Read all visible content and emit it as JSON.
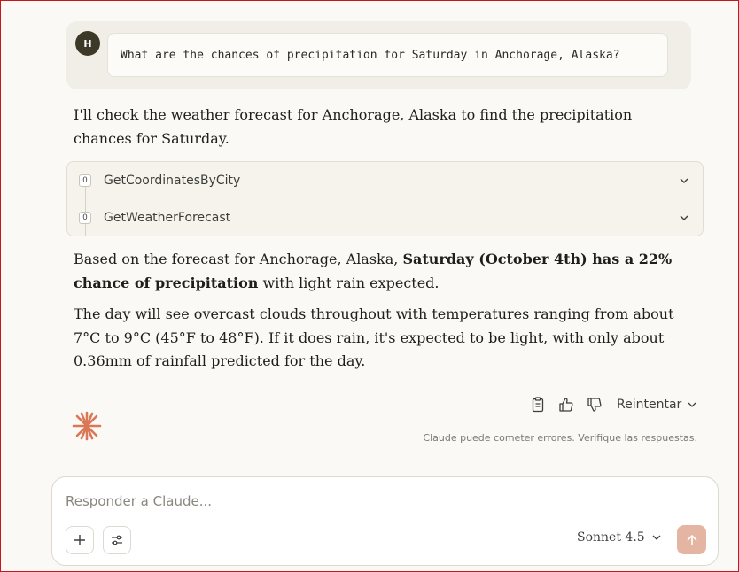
{
  "user_message": {
    "avatar_initial": "H",
    "text": "What are the chances of precipitation for Saturday in Anchorage, Alaska?"
  },
  "assistant": {
    "intro": "I'll check the weather forecast for Anchorage, Alaska to find the precipitation chances for Saturday.",
    "tools": [
      {
        "icon_text": "O",
        "name": "GetCoordinatesByCity"
      },
      {
        "icon_text": "O",
        "name": "GetWeatherForecast"
      }
    ],
    "answer_p1_pre": "Based on the forecast for Anchorage, Alaska, ",
    "answer_p1_bold": "Saturday (October 4th) has a 22% chance of precipitation",
    "answer_p1_post": " with light rain expected.",
    "answer_p2": "The day will see overcast clouds throughout with temperatures ranging from about 7°C to 9°C (45°F to 48°F). If it does rain, it's expected to be light, with only about 0.36mm of rainfall predicted for the day."
  },
  "actions": {
    "retry_label": "Reintentar"
  },
  "disclaimer": "Claude puede cometer errores. Verifique las respuestas.",
  "composer": {
    "placeholder": "Responder a Claude...",
    "value": "",
    "model_label": "Sonnet 4.5"
  },
  "colors": {
    "accent": "#d97757",
    "send_button": "#e5b5a3",
    "background": "#faf9f5"
  }
}
